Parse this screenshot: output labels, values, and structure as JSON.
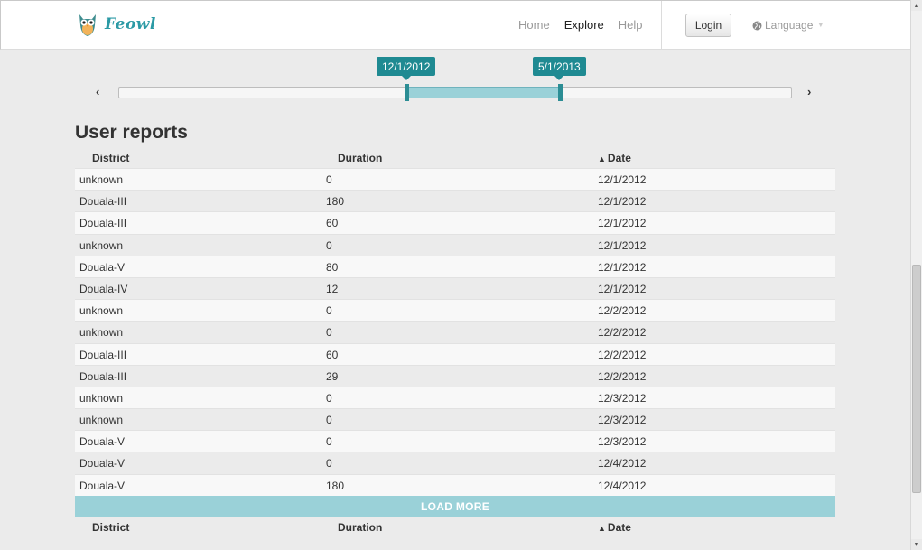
{
  "brand": {
    "name": "Feowl"
  },
  "nav": {
    "home": "Home",
    "explore": "Explore",
    "help": "Help",
    "login": "Login",
    "language": "Language"
  },
  "slider": {
    "start_label": "12/1/2012",
    "end_label": "5/1/2013",
    "prev": "‹",
    "next": "›"
  },
  "reports": {
    "title": "User reports",
    "columns": {
      "district": "District",
      "duration": "Duration",
      "date": "Date"
    },
    "load_more": "LOAD MORE",
    "rows": [
      {
        "district": "unknown",
        "duration": "0",
        "date": "12/1/2012"
      },
      {
        "district": "Douala-III",
        "duration": "180",
        "date": "12/1/2012"
      },
      {
        "district": "Douala-III",
        "duration": "60",
        "date": "12/1/2012"
      },
      {
        "district": "unknown",
        "duration": "0",
        "date": "12/1/2012"
      },
      {
        "district": "Douala-V",
        "duration": "80",
        "date": "12/1/2012"
      },
      {
        "district": "Douala-IV",
        "duration": "12",
        "date": "12/1/2012"
      },
      {
        "district": "unknown",
        "duration": "0",
        "date": "12/2/2012"
      },
      {
        "district": "unknown",
        "duration": "0",
        "date": "12/2/2012"
      },
      {
        "district": "Douala-III",
        "duration": "60",
        "date": "12/2/2012"
      },
      {
        "district": "Douala-III",
        "duration": "29",
        "date": "12/2/2012"
      },
      {
        "district": "unknown",
        "duration": "0",
        "date": "12/3/2012"
      },
      {
        "district": "unknown",
        "duration": "0",
        "date": "12/3/2012"
      },
      {
        "district": "Douala-V",
        "duration": "0",
        "date": "12/3/2012"
      },
      {
        "district": "Douala-V",
        "duration": "0",
        "date": "12/4/2012"
      },
      {
        "district": "Douala-V",
        "duration": "180",
        "date": "12/4/2012"
      }
    ]
  },
  "colors": {
    "accent": "#1f8a92",
    "range": "#9ad1d8",
    "brand": "#2b9aa5"
  }
}
